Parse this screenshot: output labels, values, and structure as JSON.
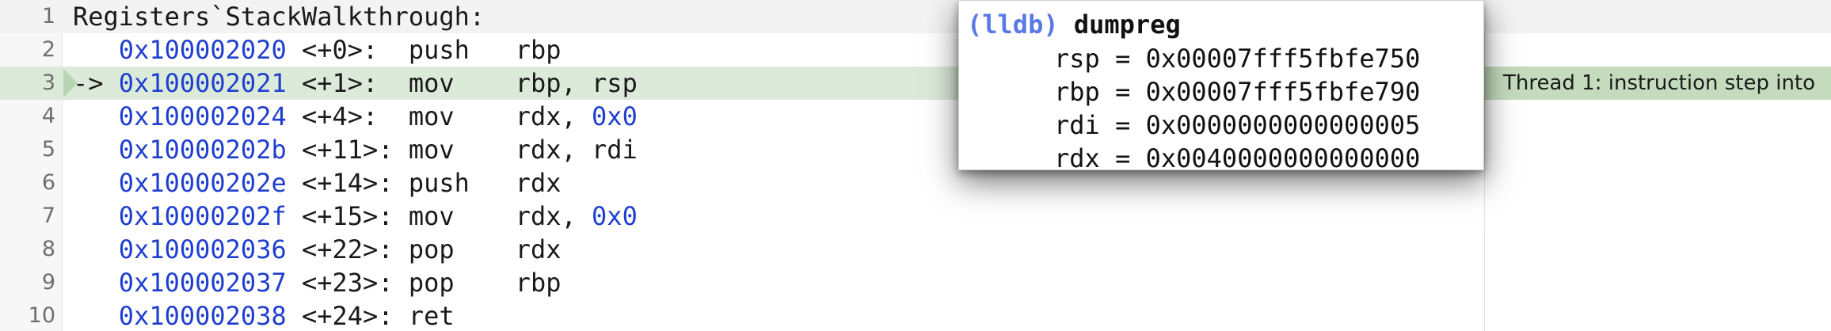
{
  "editor": {
    "lines": [
      {
        "num": "1",
        "text": "Registers`StackWalkthrough:"
      },
      {
        "num": "2",
        "addr": "0x100002020",
        "off": "<+0>:",
        "mnem": "push",
        "op1": "rbp",
        "op2": ""
      },
      {
        "num": "3",
        "pc": "->",
        "addr": "0x100002021",
        "off": "<+1>:",
        "mnem": "mov",
        "op1": "rbp,",
        "op2": "rsp"
      },
      {
        "num": "4",
        "addr": "0x100002024",
        "off": "<+4>:",
        "mnem": "mov",
        "op1": "rdx,",
        "imm": "0x0"
      },
      {
        "num": "5",
        "addr": "0x10000202b",
        "off": "<+11>:",
        "mnem": "mov",
        "op1": "rdx,",
        "op2": "rdi"
      },
      {
        "num": "6",
        "addr": "0x10000202e",
        "off": "<+14>:",
        "mnem": "push",
        "op1": "rdx",
        "op2": ""
      },
      {
        "num": "7",
        "addr": "0x10000202f",
        "off": "<+15>:",
        "mnem": "mov",
        "op1": "rdx,",
        "imm": "0x0"
      },
      {
        "num": "8",
        "addr": "0x100002036",
        "off": "<+22>:",
        "mnem": "pop",
        "op1": "rdx",
        "op2": ""
      },
      {
        "num": "9",
        "addr": "0x100002037",
        "off": "<+23>:",
        "mnem": "pop",
        "op1": "rbp",
        "op2": ""
      },
      {
        "num": "10",
        "addr": "0x100002038",
        "off": "<+24>:",
        "mnem": "ret",
        "op1": "",
        "op2": ""
      }
    ],
    "thread_note": "Thread 1: instruction step into"
  },
  "popup": {
    "prompt": "(lldb)",
    "command": "dumpreg",
    "registers": [
      {
        "name": "rsp",
        "value": "0x00007fff5fbfe750"
      },
      {
        "name": "rbp",
        "value": "0x00007fff5fbfe790"
      },
      {
        "name": "rdi",
        "value": "0x0000000000000005"
      },
      {
        "name": "rdx",
        "value": "0x0040000000000000"
      }
    ]
  },
  "colors": {
    "address": "#1f3fd0",
    "current_line": "#dcebd9",
    "thread_note_bg": "#c4dcbd",
    "prompt": "#5a78e6"
  }
}
